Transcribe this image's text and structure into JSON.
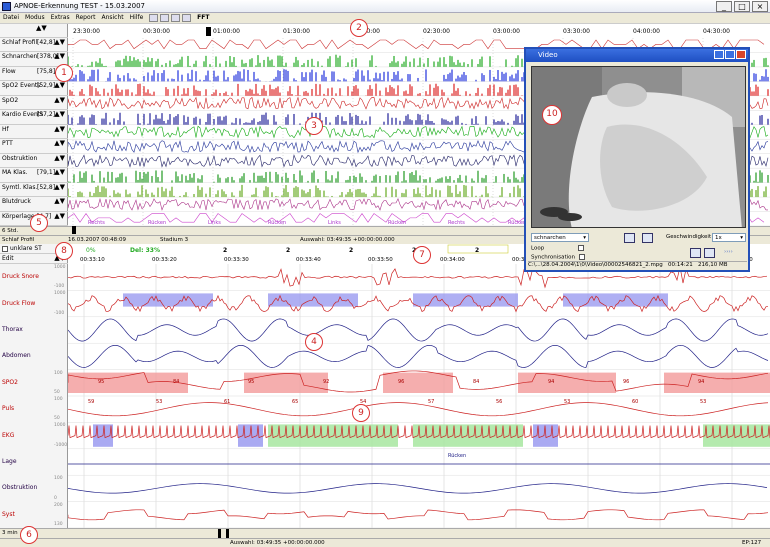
{
  "window": {
    "title": "APNOE-Erkennung TEST - 15.03.2007",
    "buttons": [
      "_",
      "□",
      "×"
    ]
  },
  "menu": [
    "Datei",
    "Modus",
    "Extras",
    "Report",
    "Ansicht",
    "Hilfe"
  ],
  "toolbar": {
    "fft": "FFT"
  },
  "overview": {
    "time_ticks": [
      "23:30:00",
      "00:30:00",
      "01:00:00",
      "01:30:00",
      "02:00:00",
      "02:30:00",
      "03:00:00",
      "03:30:00",
      "04:00:00",
      "04:30:00"
    ],
    "cursor_time": "00:30:00",
    "rows": [
      {
        "label": "Schlaf Profil",
        "value": "[42,8]"
      },
      {
        "label": "Schnarchen",
        "value": "[378,0]"
      },
      {
        "label": "Flow",
        "value": "[75,8]"
      },
      {
        "label": "SpO2 Events",
        "value": "[52,9]"
      },
      {
        "label": "SpO2",
        "value": ""
      },
      {
        "label": "Kardio Events",
        "value": "[57,2]"
      },
      {
        "label": "Hf",
        "value": ""
      },
      {
        "label": "PTT",
        "value": ""
      },
      {
        "label": "Obstruktion",
        "value": ""
      },
      {
        "label": "MA Klas.",
        "value": "[79,1]"
      },
      {
        "label": "Symtl. Klas.",
        "value": "[52,8]"
      },
      {
        "label": "Blutdruck",
        "value": ""
      },
      {
        "label": "Körperlage",
        "value": "[4,7]"
      }
    ],
    "position_labels": [
      "Rechts",
      "Rücken",
      "Links",
      "Rücken",
      "Links",
      "Rücken",
      "Rechts",
      "Rücken",
      "Links"
    ]
  },
  "middle_status": {
    "window": "6 Std.",
    "profile": "Schlaf Profil",
    "date": "16.03.2007 00:48:09",
    "stage": "Stadium 3",
    "auswahl": "Auswahl: 03:49:35 +00:00:00.000"
  },
  "detail": {
    "unklare": "unklare ST",
    "edit": "Edit",
    "epoch_label": "Del: 33%",
    "pct": "0%",
    "counts": [
      "2",
      "2",
      "2",
      "2",
      "2"
    ],
    "ticks": [
      "00:33:10",
      "00:33:20",
      "00:33:30",
      "00:33:40",
      "00:33:50",
      "00:34:00",
      "00:34:10",
      "00:34:20",
      "00:34:30",
      "00:34:40"
    ],
    "rows": [
      {
        "label": "Druck Snore",
        "color": "red",
        "scale": [
          "1000",
          "-100"
        ]
      },
      {
        "label": "Druck Flow",
        "color": "red",
        "scale": [
          "1000",
          "-100"
        ]
      },
      {
        "label": "Thorax",
        "color": "blue",
        "scale": []
      },
      {
        "label": "Abdomen",
        "color": "blue",
        "scale": []
      },
      {
        "label": "SPO2",
        "color": "red",
        "scale": [
          "100",
          "50"
        ]
      },
      {
        "label": "Puls",
        "color": "red",
        "scale": [
          "100",
          "50"
        ]
      },
      {
        "label": "EKG",
        "color": "red",
        "scale": [
          "1000",
          "-1000"
        ]
      },
      {
        "label": "Lage",
        "color": "blue",
        "scale": []
      },
      {
        "label": "Obstruktion",
        "color": "blue",
        "scale": [
          "100",
          "0"
        ]
      },
      {
        "label": "Syst",
        "color": "red",
        "scale": [
          "200",
          "130"
        ]
      }
    ],
    "spo2_values": [
      "95",
      "84",
      "95",
      "92",
      "96",
      "84",
      "94",
      "96",
      "94"
    ],
    "puls_values": [
      "59",
      "53",
      "61",
      "65",
      "54",
      "57",
      "56",
      "53",
      "60",
      "53"
    ],
    "lage_label": "Rücken"
  },
  "bottom_status": {
    "window": "3 min",
    "auswahl": "Auswahl: 03:49:35 +00:00:00.000",
    "ep": "EP:127"
  },
  "video": {
    "title": "Video",
    "channel": "schnarchen",
    "speed_label": "Geschwindigkeit",
    "speed": "1x",
    "loop": "Loop",
    "sync": "Synchronisation",
    "arrows": "››››",
    "path": "C:\\...\\28.04.2004\\1\\0\\Video\\00002546821_2.mpg",
    "time": "00:14:21",
    "size": "216,10 MB"
  },
  "markers": [
    "1",
    "2",
    "3",
    "4",
    "5",
    "6",
    "7",
    "8",
    "9",
    "10"
  ]
}
